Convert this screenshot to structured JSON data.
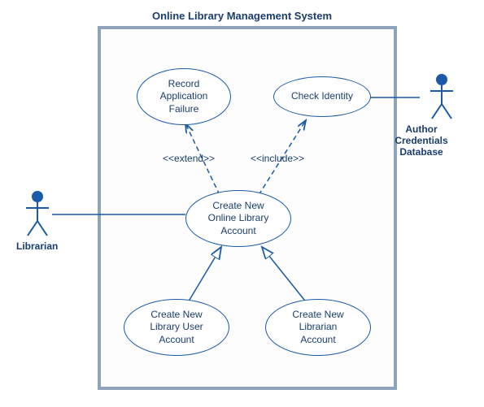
{
  "system_title": "Online Library Management System",
  "actors": {
    "librarian": "Librarian",
    "credentials_db": "Author Credentials\nDatabase"
  },
  "usecases": {
    "record_failure": "Record\nApplication\nFailure",
    "check_identity": "Check Identity",
    "create_account": "Create New\nOnline Library\nAccount",
    "create_user_account": "Create New\nLibrary User\nAccount",
    "create_librarian_account": "Create New\nLibrarian\nAccount"
  },
  "relationships": {
    "extend": "<<extend>>",
    "include": "<<include>>"
  }
}
